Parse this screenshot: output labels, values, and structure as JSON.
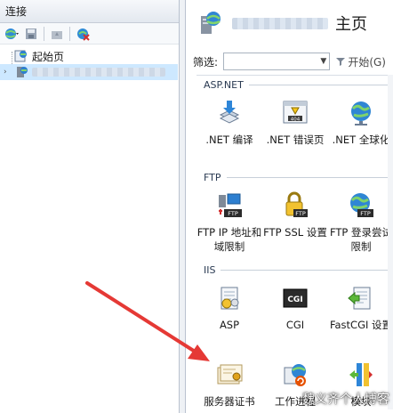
{
  "connections": {
    "title": "连接",
    "tree": [
      {
        "label": "起始页"
      },
      {
        "label": ""
      }
    ]
  },
  "features": {
    "page_title": "主页",
    "filter_label": "筛选:",
    "start_button": "开始(G)",
    "groups": [
      {
        "title": "ASP.NET",
        "items": [
          {
            "label": ".NET 编译",
            "icon": "net-compile-icon"
          },
          {
            "label": ".NET 错误页",
            "icon": "404-page-icon"
          },
          {
            "label": ".NET 全球化",
            "icon": "globe-icon"
          }
        ]
      },
      {
        "title": "FTP",
        "items": [
          {
            "label": "FTP IP 地址和域限制",
            "icon": "ftp-ip-icon"
          },
          {
            "label": "FTP SSL 设置",
            "icon": "ftp-lock-icon"
          },
          {
            "label": "FTP 登录尝试限制",
            "icon": "ftp-globe-icon"
          }
        ]
      },
      {
        "title": "IIS",
        "items": [
          {
            "label": "ASP",
            "icon": "asp-icon"
          },
          {
            "label": "CGI",
            "icon": "cgi-icon"
          },
          {
            "label": "FastCGI 设置",
            "icon": "fastcgi-icon"
          },
          {
            "label": "服务器证书",
            "icon": "certificate-icon"
          },
          {
            "label": "工作进程",
            "icon": "worker-process-icon"
          },
          {
            "label": "模块",
            "icon": "modules-icon"
          }
        ]
      }
    ]
  },
  "watermark": "魏义齐个人博客",
  "colors": {
    "accent": "#e53935",
    "tree_select": "#cde8ff"
  }
}
